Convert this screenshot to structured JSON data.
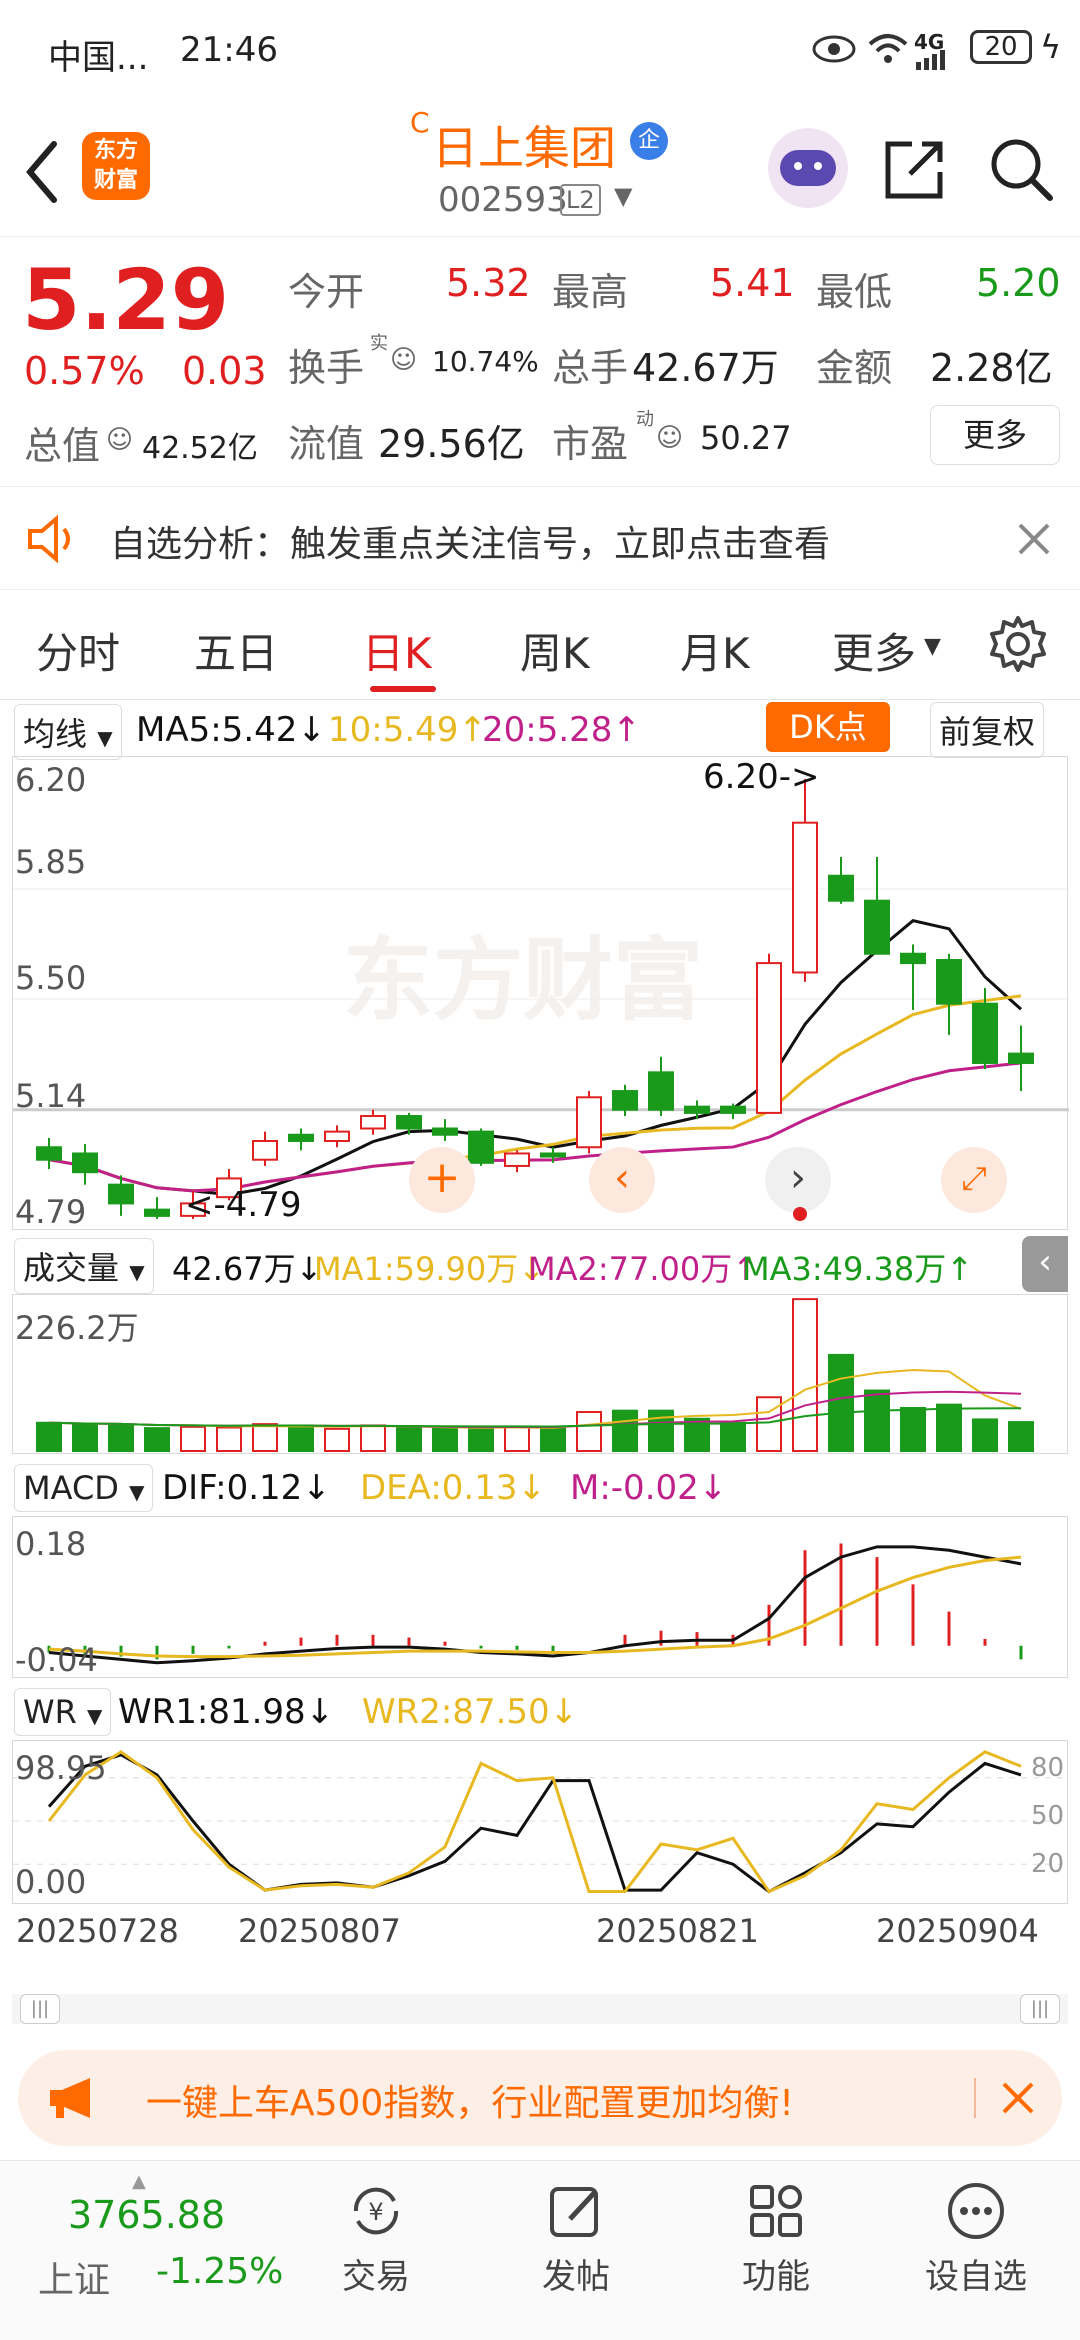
{
  "status": {
    "carrier": "中国...",
    "time": "21:46",
    "network": "4G",
    "battery": "20"
  },
  "header": {
    "superscript": "C",
    "title": "日上集团",
    "badge": "企",
    "code": "002593",
    "level": "L2",
    "logo_text": "东方财富"
  },
  "quote": {
    "price": "5.29",
    "change_pct": "0.57%",
    "change": "0.03",
    "open_label": "今开",
    "open": "5.32",
    "high_label": "最高",
    "high": "5.41",
    "low_label": "最低",
    "low": "5.20",
    "turnover_label": "换手",
    "turnover_sup": "实",
    "turnover": "10.74%",
    "volume_label": "总手",
    "volume": "42.67万",
    "amount_label": "金额",
    "amount": "2.28亿",
    "mktcap_label": "总值",
    "mktcap": "42.52亿",
    "float_label": "流值",
    "float": "29.56亿",
    "pe_label": "市盈",
    "pe_sup": "动",
    "pe": "50.27",
    "more_label": "更多"
  },
  "banner": {
    "text": "自选分析：触发重点关注信号，立即点击查看"
  },
  "tabs": [
    "分时",
    "五日",
    "日K",
    "周K",
    "月K",
    "更多"
  ],
  "active_tab": 2,
  "ma_row": {
    "select": "均线",
    "ma5": "MA5:5.42↓",
    "ma10": "10:5.49↑",
    "ma20": "20:5.28↑",
    "dk": "DK点",
    "adjust": "前复权"
  },
  "price_panel": {
    "y_labels": [
      "6.20",
      "5.85",
      "5.50",
      "5.14",
      "4.79"
    ],
    "high_note": "6.20->",
    "low_note": "<-4.79",
    "watermark": "东方财富"
  },
  "volume_row": {
    "select": "成交量",
    "vol": "42.67万↓",
    "ma1": "MA1:59.90万↓",
    "ma2": "MA2:77.00万↑",
    "ma3": "MA3:49.38万↑",
    "y_label": "226.2万"
  },
  "macd_row": {
    "select": "MACD",
    "dif": "DIF:0.12↓",
    "dea": "DEA:0.13↓",
    "m": "M:-0.02↓",
    "y_top": "0.18",
    "y_bottom": "-0.04"
  },
  "wr_row": {
    "select": "WR",
    "wr1": "WR1:81.98↓",
    "wr2": "WR2:87.50↓",
    "y_top": "98.95",
    "y_bottom": "0.00",
    "right_ticks": [
      "80",
      "50",
      "20"
    ]
  },
  "dates": [
    "20250728",
    "20250807",
    "20250821",
    "20250904"
  ],
  "promo": {
    "text": "一键上车A500指数，行业配置更加均衡!"
  },
  "bottom_nav": {
    "index_value": "3765.88",
    "index_name": "上证",
    "index_change": "-1.25%",
    "items": [
      "交易",
      "发帖",
      "功能",
      "设自选"
    ]
  },
  "colors": {
    "up": "#e02020",
    "down": "#1a9a1a",
    "accent": "#ff6a00",
    "ma5": "#111111",
    "ma10": "#e8b820",
    "ma20": "#c0208a"
  },
  "chart_data": {
    "type": "candlestick",
    "ylim": [
      4.79,
      6.2
    ],
    "candles": [
      {
        "o": 5.02,
        "c": 4.98,
        "h": 5.05,
        "l": 4.95
      },
      {
        "o": 5.0,
        "c": 4.94,
        "h": 5.03,
        "l": 4.9
      },
      {
        "o": 4.9,
        "c": 4.84,
        "h": 4.93,
        "l": 4.8
      },
      {
        "o": 4.82,
        "c": 4.8,
        "h": 4.86,
        "l": 4.79
      },
      {
        "o": 4.8,
        "c": 4.84,
        "h": 4.88,
        "l": 4.79
      },
      {
        "o": 4.86,
        "c": 4.92,
        "h": 4.95,
        "l": 4.85
      },
      {
        "o": 4.98,
        "c": 5.04,
        "h": 5.07,
        "l": 4.96
      },
      {
        "o": 5.06,
        "c": 5.04,
        "h": 5.08,
        "l": 5.01
      },
      {
        "o": 5.04,
        "c": 5.07,
        "h": 5.09,
        "l": 5.02
      },
      {
        "o": 5.08,
        "c": 5.12,
        "h": 5.14,
        "l": 5.06
      },
      {
        "o": 5.12,
        "c": 5.08,
        "h": 5.13,
        "l": 5.06
      },
      {
        "o": 5.08,
        "c": 5.06,
        "h": 5.11,
        "l": 5.04
      },
      {
        "o": 5.07,
        "c": 4.97,
        "h": 5.08,
        "l": 4.96
      },
      {
        "o": 4.96,
        "c": 5.0,
        "h": 5.01,
        "l": 4.94
      },
      {
        "o": 5.0,
        "c": 4.99,
        "h": 5.02,
        "l": 4.97
      },
      {
        "o": 5.02,
        "c": 5.18,
        "h": 5.2,
        "l": 5.0
      },
      {
        "o": 5.2,
        "c": 5.14,
        "h": 5.22,
        "l": 5.12
      },
      {
        "o": 5.26,
        "c": 5.14,
        "h": 5.31,
        "l": 5.12
      },
      {
        "o": 5.15,
        "c": 5.13,
        "h": 5.17,
        "l": 5.11
      },
      {
        "o": 5.15,
        "c": 5.13,
        "h": 5.16,
        "l": 5.11
      },
      {
        "o": 5.13,
        "c": 5.61,
        "h": 5.64,
        "l": 5.13
      },
      {
        "o": 5.58,
        "c": 6.06,
        "h": 6.2,
        "l": 5.55
      },
      {
        "o": 5.89,
        "c": 5.81,
        "h": 5.95,
        "l": 5.8
      },
      {
        "o": 5.81,
        "c": 5.64,
        "h": 5.95,
        "l": 5.64
      },
      {
        "o": 5.64,
        "c": 5.61,
        "h": 5.67,
        "l": 5.46
      },
      {
        "o": 5.62,
        "c": 5.48,
        "h": 5.64,
        "l": 5.38
      },
      {
        "o": 5.48,
        "c": 5.29,
        "h": 5.53,
        "l": 5.27
      },
      {
        "o": 5.32,
        "c": 5.29,
        "h": 5.41,
        "l": 5.2
      }
    ],
    "volume": [
      42,
      40,
      39,
      34,
      36,
      35,
      40,
      38,
      33,
      38,
      35,
      33,
      34,
      35,
      35,
      58,
      60,
      60,
      48,
      42,
      80,
      226,
      143,
      90,
      64,
      69,
      47,
      43
    ],
    "volume_max": 226.2,
    "macd": {
      "ylim": [
        -0.04,
        0.18
      ],
      "dif": [
        -0.01,
        -0.015,
        -0.02,
        -0.025,
        -0.022,
        -0.018,
        -0.012,
        -0.008,
        -0.004,
        -0.002,
        -0.002,
        -0.005,
        -0.01,
        -0.012,
        -0.015,
        -0.01,
        0.0,
        0.006,
        0.008,
        0.008,
        0.04,
        0.1,
        0.13,
        0.145,
        0.145,
        0.14,
        0.13,
        0.12
      ],
      "dea": [
        -0.005,
        -0.008,
        -0.012,
        -0.015,
        -0.016,
        -0.016,
        -0.015,
        -0.014,
        -0.012,
        -0.01,
        -0.008,
        -0.008,
        -0.008,
        -0.009,
        -0.01,
        -0.01,
        -0.008,
        -0.005,
        -0.002,
        0.0,
        0.01,
        0.03,
        0.055,
        0.08,
        0.1,
        0.115,
        0.125,
        0.13
      ],
      "m": [
        -0.01,
        -0.014,
        -0.016,
        -0.02,
        -0.012,
        -0.004,
        0.006,
        0.012,
        0.016,
        0.016,
        0.012,
        0.006,
        -0.004,
        -0.006,
        -0.01,
        0.0,
        0.016,
        0.022,
        0.02,
        0.016,
        0.06,
        0.14,
        0.15,
        0.13,
        0.09,
        0.05,
        0.01,
        -0.02
      ]
    },
    "wr": {
      "ylim": [
        0,
        100
      ],
      "wr1": [
        60,
        88,
        96,
        82,
        50,
        20,
        2,
        6,
        7,
        4,
        12,
        22,
        45,
        40,
        78,
        78,
        2,
        2,
        28,
        20,
        1,
        14,
        28,
        48,
        46,
        70,
        90,
        82
      ],
      "wr2": [
        50,
        82,
        98,
        80,
        44,
        18,
        2,
        5,
        6,
        4,
        14,
        32,
        90,
        78,
        80,
        1,
        1,
        34,
        30,
        38,
        1,
        12,
        30,
        62,
        58,
        80,
        98,
        88
      ]
    }
  }
}
